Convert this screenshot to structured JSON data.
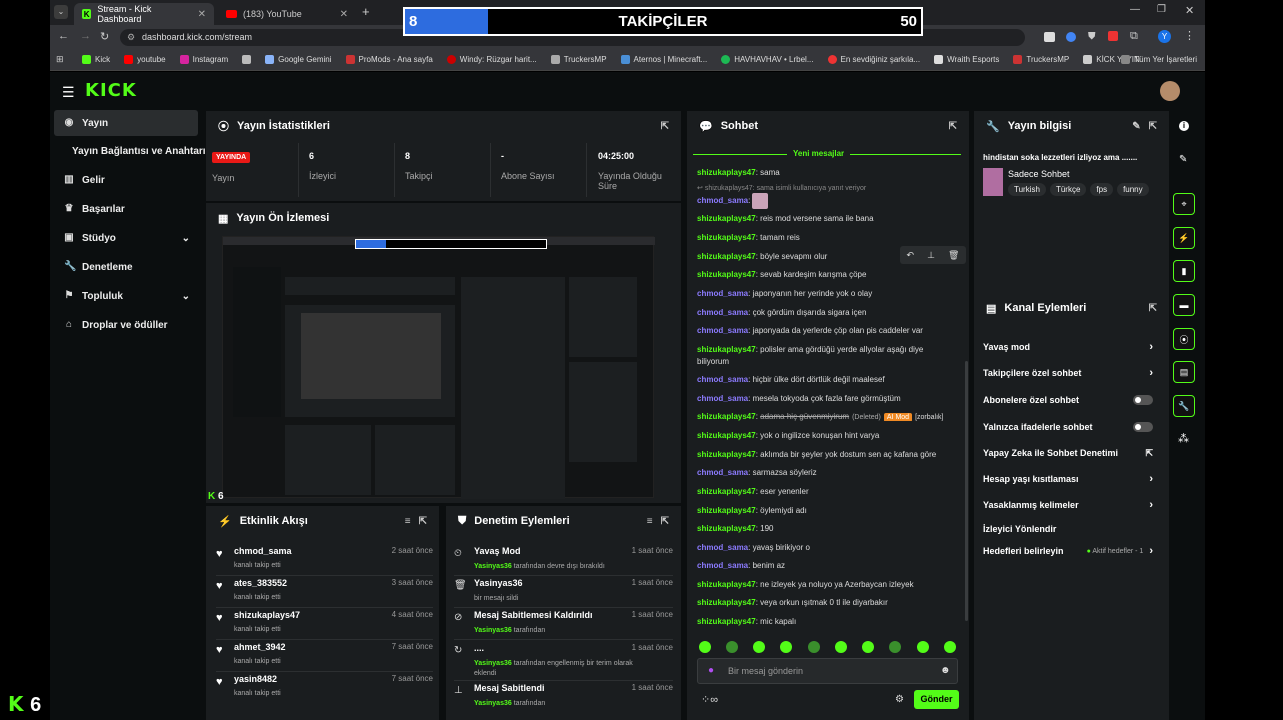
{
  "browser": {
    "tabs": [
      {
        "label": "Stream - Kick Dashboard"
      },
      {
        "label": "(183) YouTube"
      }
    ],
    "url": "dashboard.kick.com/stream",
    "bookmarks": [
      "Kick",
      "youtube",
      "Instagram",
      "Google Gemini",
      "ProMods - Ana sayfa",
      "Windy: Rüzgar harit...",
      "TruckersMP",
      "Aternos | Minecraft...",
      "HAVHAVHAV • Lrbel...",
      "En sevdiğiniz şarkıla...",
      "Wraith Esports",
      "TruckersMP",
      "KİCK YAYIN"
    ],
    "bookmarks_all": "Tüm Yer İşaretleri",
    "profile_initial": "Y"
  },
  "overlay": {
    "current": "8",
    "title": "TAKİPÇİLER",
    "goal": "50",
    "progress": 0.16
  },
  "app": {
    "logo": "KICK",
    "sidebar": [
      {
        "label": "Yayın",
        "icon": "radio-icon",
        "active": true
      },
      {
        "label": "Yayın Bağlantısı ve Anahtarı"
      },
      {
        "label": "Gelir",
        "icon": "chart-icon"
      },
      {
        "label": "Başarılar",
        "icon": "trophy-icon"
      },
      {
        "label": "Stüdyo",
        "icon": "studio-icon",
        "chevron": true
      },
      {
        "label": "Denetleme",
        "icon": "wrench-icon"
      },
      {
        "label": "Topluluk",
        "icon": "community-icon",
        "chevron": true
      },
      {
        "label": "Droplar ve ödüller",
        "icon": "gift-icon"
      }
    ],
    "stats_panel": {
      "title": "Yayın İstatistikleri",
      "live_badge": "YAYINDA",
      "live_label": "Yayın",
      "items": [
        {
          "value": "6",
          "label": "İzleyici"
        },
        {
          "value": "8",
          "label": "Takipçi"
        },
        {
          "value": "-",
          "label": "Abone Sayısı"
        },
        {
          "value": "04:25:00",
          "label": "Yayında Olduğu Süre"
        }
      ]
    },
    "preview_panel": {
      "title": "Yayın Ön İzlemesi",
      "viewer_count": "6"
    },
    "activity_panel": {
      "title": "Etkinlik Akışı",
      "items": [
        {
          "user": "chmod_sama",
          "sub": "kanalı takip etti",
          "time": "2 saat önce"
        },
        {
          "user": "ates_383552",
          "sub": "kanalı takip etti",
          "time": "3 saat önce"
        },
        {
          "user": "shizukaplays47",
          "sub": "kanalı takip etti",
          "time": "4 saat önce"
        },
        {
          "user": "ahmet_3942",
          "sub": "kanalı takip etti",
          "time": "7 saat önce"
        },
        {
          "user": "yasin8482",
          "sub": "kanalı takip etti",
          "time": "7 saat önce"
        }
      ]
    },
    "moderation_panel": {
      "title": "Denetim Eylemleri",
      "items": [
        {
          "title": "Yavaş Mod",
          "user": "Yasinyas36",
          "sub": " tarafından devre dışı bırakıldı",
          "time": "1 saat önce",
          "icon": "slow-mode-icon"
        },
        {
          "title": "Yasinyas36",
          "user": "",
          "sub": "bir mesajı sildi",
          "time": "1 saat önce",
          "icon": "trash-icon"
        },
        {
          "title": "Mesaj Sabitlemesi Kaldırıldı",
          "user": "Yasinyas36",
          "sub": " tarafından",
          "time": "1 saat önce",
          "icon": "unpin-icon"
        },
        {
          "title": "....",
          "user": "Yasinyas36",
          "sub": " tarafından engellenmiş bir terim olarak eklendi",
          "time": "1 saat önce",
          "icon": "refresh-icon"
        },
        {
          "title": "Mesaj Sabitlendi",
          "user": "Yasinyas36",
          "sub": " tarafından",
          "time": "1 saat önce",
          "icon": "pin-icon"
        }
      ]
    },
    "chat_panel": {
      "title": "Sohbet",
      "new_messages": "Yeni mesajlar",
      "reply_hint": "shizukaplays47: sama isimli kullanıcıya yanıt veriyor",
      "messages": [
        {
          "user": "shizukaplays47",
          "text": "sama",
          "c": "u1"
        },
        {
          "user": "chmod_sama",
          "text": "",
          "c": "u2"
        },
        {
          "user": "shizukaplays47",
          "text": "reis mod versene sama ile bana",
          "c": "u1"
        },
        {
          "user": "shizukaplays47",
          "text": "tamam reis",
          "c": "u1"
        },
        {
          "user": "shizukaplays47",
          "text": "böyle sevapmı olur",
          "c": "u1"
        },
        {
          "user": "shizukaplays47",
          "text": "sevab kardeşim karışma çöpe",
          "c": "u1"
        },
        {
          "user": "chmod_sama",
          "text": "japonyanın her yerinde yok o olay",
          "c": "u2"
        },
        {
          "user": "chmod_sama",
          "text": "çok gördüm dışarıda sigara içen",
          "c": "u2"
        },
        {
          "user": "chmod_sama",
          "text": "japonyada da yerlerde çöp olan pis caddeler var",
          "c": "u2"
        },
        {
          "user": "shizukaplays47",
          "text": "polisler ama gördüğü yerde allyolar aşağı diye",
          "c": "u1"
        },
        {
          "user": "",
          "text": "biliyorum",
          "c": "u1"
        },
        {
          "user": "chmod_sama",
          "text": "hiçbir ülke dört dörtlük değil maalesef",
          "c": "u2"
        },
        {
          "user": "chmod_sama",
          "text": "mesela tokyoda çok fazla fare görmüştüm",
          "c": "u2"
        },
        {
          "user": "shizukaplays47",
          "text": "adama hiç güvenmiyirum",
          "c": "u1",
          "deleted": "(Deleted)",
          "mod": "AI Mod",
          "extra": "[zorbalık]"
        },
        {
          "user": "shizukaplays47",
          "text": "yok o ingilizce konuşan hint varya",
          "c": "u1"
        },
        {
          "user": "shizukaplays47",
          "text": "aklımda bir şeyler yok dostum sen aç kafana göre",
          "c": "u1"
        },
        {
          "user": "chmod_sama",
          "text": "sarmazsa söyleriz",
          "c": "u2"
        },
        {
          "user": "shizukaplays47",
          "text": "eser yenenler",
          "c": "u1"
        },
        {
          "user": "shizukaplays47",
          "text": "öylemiydi adı",
          "c": "u1"
        },
        {
          "user": "shizukaplays47",
          "text": "190",
          "c": "u1"
        },
        {
          "user": "chmod_sama",
          "text": "yavaş birikiyor o",
          "c": "u2"
        },
        {
          "user": "chmod_sama",
          "text": "benim az",
          "c": "u2"
        },
        {
          "user": "shizukaplays47",
          "text": "ne izleyek ya noluyo ya Azerbaycan izleyek",
          "c": "u1"
        },
        {
          "user": "shizukaplays47",
          "text": "veya orkun ışıtmak 0 tl ile diyarbakır",
          "c": "u1"
        },
        {
          "user": "shizukaplays47",
          "text": "mic kapalı",
          "c": "u1"
        }
      ],
      "input_placeholder": "Bir mesaj gönderin",
      "send": "Gönder"
    },
    "info_panel": {
      "title": "Yayın bilgisi",
      "stream_title": "hindistan soka lezzetleri izliyoz ama .......",
      "category": "Sadece Sohbet",
      "tags": [
        "Turkish",
        "Türkçe",
        "fps",
        "funny"
      ]
    },
    "channel_actions": {
      "title": "Kanal Eylemleri",
      "items": [
        {
          "label": "Yavaş mod",
          "control": "chevron"
        },
        {
          "label": "Takipçilere özel sohbet",
          "control": "chevron"
        },
        {
          "label": "Abonelere özel sohbet",
          "control": "toggle"
        },
        {
          "label": "Yalnızca ifadelerle sohbet",
          "control": "toggle"
        },
        {
          "label": "Yapay Zeka ile Sohbet Denetimi",
          "control": "external"
        },
        {
          "label": "Hesap yaşı kısıtlaması",
          "control": "chevron"
        },
        {
          "label": "Yasaklanmış kelimeler",
          "control": "chevron"
        },
        {
          "label": "İzleyici Yönlendir",
          "control": "none"
        },
        {
          "label": "Hedefleri belirleyin",
          "control": "chevron",
          "status": "Aktif hedefler - 1"
        }
      ]
    },
    "corner": {
      "count": "6"
    }
  }
}
